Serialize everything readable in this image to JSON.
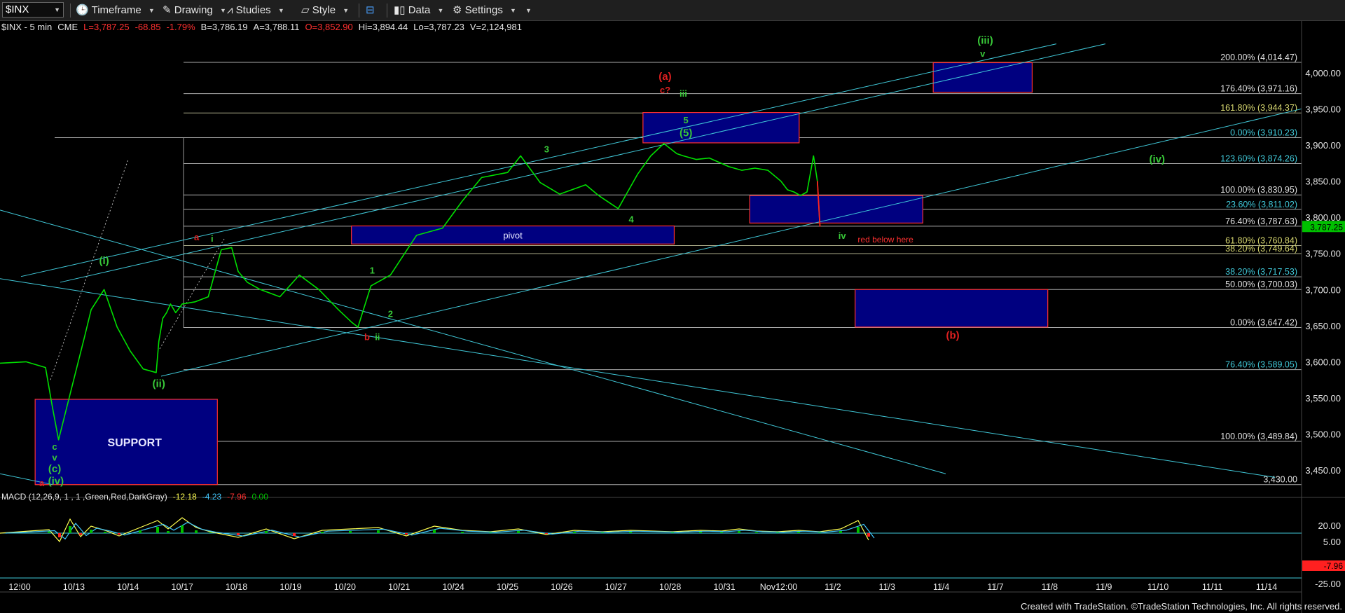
{
  "toolbar": {
    "symbol": "$INX",
    "timeframe": "Timeframe",
    "drawing": "Drawing",
    "studies": "Studies",
    "style": "Style",
    "data": "Data",
    "settings": "Settings"
  },
  "colors": {
    "up": "#00e000",
    "down": "#ff2020",
    "fib": "#c8c8c8",
    "fib_alt": "#c8c8a0",
    "channel": "#40c8d8",
    "box_fill": "#000080",
    "box_border": "#ff3030",
    "wave_green": "#38c838",
    "wave_red": "#e02020",
    "price_tag": "#00c000"
  },
  "chart_data": {
    "type": "line",
    "title": "",
    "header": {
      "symbol": "$INX - 5 min",
      "exchange": "CME",
      "last": "L=3,787.25",
      "change": "-68.85",
      "change_pct": "-1.79%",
      "bid": "B=3,786.19",
      "ask": "A=3,788.11",
      "open": "O=3,852.90",
      "high": "Hi=3,894.44",
      "low": "Lo=3,787.23",
      "volume": "V=2,124,981"
    },
    "y_axis_ticks": [
      "4,000.00",
      "3,950.00",
      "3,900.00",
      "3,850.00",
      "3,800.00",
      "3,750.00",
      "3,700.00",
      "3,650.00",
      "3,600.00",
      "3,550.00",
      "3,500.00",
      "3,450.00"
    ],
    "ylim": [
      3420,
      4060
    ],
    "x_axis_ticks": [
      "12:00",
      "10/13",
      "10/14",
      "10/17",
      "10/18",
      "10/19",
      "10/20",
      "10/21",
      "10/24",
      "10/25",
      "10/26",
      "10/27",
      "10/28",
      "10/31",
      "Nov12:00",
      "11/2",
      "11/3",
      "11/4",
      "11/7",
      "11/8",
      "11/9",
      "11/10",
      "11/11",
      "11/14"
    ],
    "current_price_label": "3,787.25",
    "series": [
      {
        "x": [
          0,
          0.02,
          0.035,
          0.04,
          0.045,
          0.065,
          0.07,
          0.08,
          0.09,
          0.1,
          0.11,
          0.12,
          0.122,
          0.125,
          0.128,
          0.131,
          0.135,
          0.14,
          0.15,
          0.16,
          0.17,
          0.178,
          0.183,
          0.19,
          0.2,
          0.215,
          0.23,
          0.245,
          0.26,
          0.27,
          0.275,
          0.285,
          0.3,
          0.32,
          0.34,
          0.355,
          0.37,
          0.39,
          0.4,
          0.415,
          0.43,
          0.45,
          0.46,
          0.475,
          0.49,
          0.5,
          0.51,
          0.52,
          0.525,
          0.535,
          0.545,
          0.56,
          0.57,
          0.58,
          0.59,
          0.6,
          0.605,
          0.61,
          0.615,
          0.62,
          0.625,
          0.628,
          0.63
        ],
        "y": [
          3598,
          3600,
          3592,
          3540,
          3492,
          3635,
          3672,
          3700,
          3648,
          3615,
          3590,
          3585,
          3628,
          3660,
          3668,
          3680,
          3668,
          3680,
          3683,
          3690,
          3755,
          3758,
          3725,
          3710,
          3700,
          3690,
          3720,
          3700,
          3672,
          3655,
          3648,
          3705,
          3720,
          3775,
          3785,
          3822,
          3855,
          3862,
          3885,
          3848,
          3832,
          3845,
          3830,
          3812,
          3860,
          3885,
          3902,
          3888,
          3885,
          3880,
          3882,
          3870,
          3865,
          3868,
          3865,
          3850,
          3838,
          3835,
          3830,
          3835,
          3885,
          3850,
          3787
        ]
      }
    ],
    "fib_levels": [
      {
        "label": "200.00% (4,014.47)",
        "value": 4014.47
      },
      {
        "label": "176.40% (3,971.16)",
        "value": 3971.16
      },
      {
        "label": "161.80% (3,944.37)",
        "value": 3944.37
      },
      {
        "label": "0.00% (3,910.23)",
        "value": 3910.23
      },
      {
        "label": "123.60% (3,874.26)",
        "value": 3874.26
      },
      {
        "label": "100.00% (3,830.95)",
        "value": 3830.95
      },
      {
        "label": "23.60% (3,811.02)",
        "value": 3811.02
      },
      {
        "label": "76.40% (3,787.63)",
        "value": 3787.63
      },
      {
        "label": "61.80% (3,760.84)",
        "value": 3760.84
      },
      {
        "label": "38.20% (3,749.64)",
        "value": 3749.64
      },
      {
        "label": "38.20% (3,717.53)",
        "value": 3717.53
      },
      {
        "label": "50.00% (3,700.03)",
        "value": 3700.03
      },
      {
        "label": "0.00% (3,647.42)",
        "value": 3647.42
      },
      {
        "label": "76.40% (3,589.05)",
        "value": 3589.05
      },
      {
        "label": "100.00% (3,489.84)",
        "value": 3489.84
      },
      {
        "label": "3,430.00",
        "value": 3430.0
      }
    ],
    "boxes": [
      {
        "label": "SUPPORT",
        "x0": 0.027,
        "x1": 0.167,
        "y0": 3430,
        "y1": 3548
      },
      {
        "label": "pivot",
        "x0": 0.27,
        "x1": 0.518,
        "y0": 3763,
        "y1": 3788
      },
      {
        "label": "",
        "x0": 0.494,
        "x1": 0.614,
        "y0": 3903,
        "y1": 3945
      },
      {
        "label": "",
        "x0": 0.717,
        "x1": 0.793,
        "y0": 3973,
        "y1": 4014
      },
      {
        "label": "",
        "x0": 0.576,
        "x1": 0.709,
        "y0": 3792,
        "y1": 3830
      },
      {
        "label": "",
        "x0": 0.657,
        "x1": 0.805,
        "y0": 3648,
        "y1": 3700
      }
    ],
    "wave_labels": [
      {
        "text": "(iii)",
        "x": 0.757,
        "y": 4040,
        "color": "green"
      },
      {
        "text": "v",
        "x": 0.755,
        "y": 4022,
        "color": "green"
      },
      {
        "text": "(a)",
        "x": 0.511,
        "y": 3990,
        "color": "red"
      },
      {
        "text": "c?",
        "x": 0.511,
        "y": 3972,
        "color": "red"
      },
      {
        "text": "iii",
        "x": 0.525,
        "y": 3967,
        "color": "green"
      },
      {
        "text": "5",
        "x": 0.527,
        "y": 3930,
        "color": "green"
      },
      {
        "text": "(5)",
        "x": 0.527,
        "y": 3912,
        "color": "green"
      },
      {
        "text": "3",
        "x": 0.42,
        "y": 3890,
        "color": "green"
      },
      {
        "text": "4",
        "x": 0.485,
        "y": 3793,
        "color": "green"
      },
      {
        "text": "(iv)",
        "x": 0.889,
        "y": 3876,
        "color": "green"
      },
      {
        "text": "iv",
        "x": 0.647,
        "y": 3770,
        "color": "green"
      },
      {
        "text": "a",
        "x": 0.151,
        "y": 3768,
        "color": "red"
      },
      {
        "text": "i",
        "x": 0.163,
        "y": 3766,
        "color": "green"
      },
      {
        "text": "(i)",
        "x": 0.08,
        "y": 3735,
        "color": "green"
      },
      {
        "text": "1",
        "x": 0.286,
        "y": 3722,
        "color": "green"
      },
      {
        "text": "2",
        "x": 0.3,
        "y": 3662,
        "color": "green"
      },
      {
        "text": "b",
        "x": 0.282,
        "y": 3630,
        "color": "red"
      },
      {
        "text": "ii",
        "x": 0.29,
        "y": 3630,
        "color": "green"
      },
      {
        "text": "(b)",
        "x": 0.732,
        "y": 3632,
        "color": "red"
      },
      {
        "text": "(ii)",
        "x": 0.122,
        "y": 3565,
        "color": "green"
      },
      {
        "text": "c",
        "x": 0.042,
        "y": 3478,
        "color": "green"
      },
      {
        "text": "v",
        "x": 0.042,
        "y": 3463,
        "color": "green"
      },
      {
        "text": "(c)",
        "x": 0.042,
        "y": 3447,
        "color": "green"
      },
      {
        "text": "a",
        "x": 0.032,
        "y": 3428,
        "color": "red"
      },
      {
        "text": "(iv)",
        "x": 0.043,
        "y": 3430,
        "color": "green"
      }
    ],
    "annotation_text": "red below here",
    "macd": {
      "label": "MACD (12,26,9, 1 , 1 ,Green,Red,DarkGray)",
      "values": [
        "-12.18",
        "-4.23",
        "-7.96",
        "0.00"
      ],
      "y_axis_ticks": [
        "20.00",
        "5.00",
        "-25.00"
      ],
      "current_label": "-7.96"
    }
  },
  "footer": {
    "credit": "Created with TradeStation. ©TradeStation Technologies, Inc. All rights reserved."
  }
}
